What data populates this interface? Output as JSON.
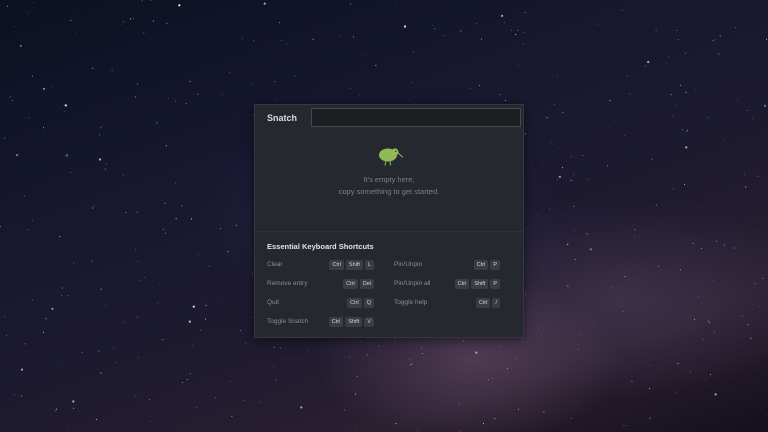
{
  "app": {
    "title": "Snatch",
    "search": {
      "value": "",
      "placeholder": ""
    }
  },
  "empty_state": {
    "icon": "kiwi-bird-icon",
    "icon_color": "#8fba55",
    "line1": "It's empty here,",
    "line2": "copy something to get started."
  },
  "shortcuts": {
    "heading": "Essential Keyboard Shortcuts",
    "left": [
      {
        "label": "Clear",
        "keys": [
          "Ctrl",
          "Shift",
          "L"
        ]
      },
      {
        "label": "Remove entry",
        "keys": [
          "Ctrl",
          "Del"
        ]
      },
      {
        "label": "Quit",
        "keys": [
          "Ctrl",
          "Q"
        ]
      },
      {
        "label": "Toggle Snatch",
        "keys": [
          "Ctrl",
          "Shift",
          "V"
        ]
      }
    ],
    "right": [
      {
        "label": "Pin/Unpin",
        "keys": [
          "Ctrl",
          "P"
        ]
      },
      {
        "label": "Pin/Unpin all",
        "keys": [
          "Ctrl",
          "Shift",
          "P"
        ]
      },
      {
        "label": "Toggle help",
        "keys": [
          "Ctrl",
          "/"
        ]
      }
    ]
  },
  "colors": {
    "window_bg": "#25282e",
    "accent": "#8fba55"
  }
}
